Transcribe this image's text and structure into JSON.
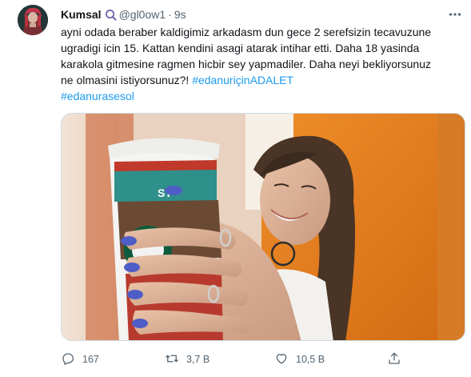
{
  "tweet": {
    "display_name": "Kumsal",
    "handle": "@gl0ow1",
    "separator": "·",
    "time": "9s",
    "text_line1": "ayni odada beraber kaldigimiz arkadasm dun gece 2 serefsizin tecavuzune",
    "text_line2": "ugradigi icin 15. Kattan kendini asagi atarak intihar etti. Daha 18 yasinda",
    "text_line3": "karakola gitmesine ragmen hicbir sey yapmadiler. Daha neyi bekliyorsunuz",
    "text_line4_plain": "ne olmasini istiyorsunuz?! ",
    "hashtag1": "#edanuriçinADALET",
    "hashtag2": "#edanurasesol",
    "media_cup_text": "ST"
  },
  "actions": {
    "reply_count": "167",
    "retweet_count": "3,7 B",
    "like_count": "10,5 B"
  },
  "icons": {
    "verified_badge": "magnifier-badge-icon",
    "more": "more-icon",
    "reply": "reply-icon",
    "retweet": "retweet-icon",
    "like": "heart-icon",
    "share": "share-icon"
  },
  "colors": {
    "link": "#1d9bf0",
    "secondary_text": "#536471",
    "primary_text": "#0f1419",
    "media_orange": "#e07a1c"
  }
}
